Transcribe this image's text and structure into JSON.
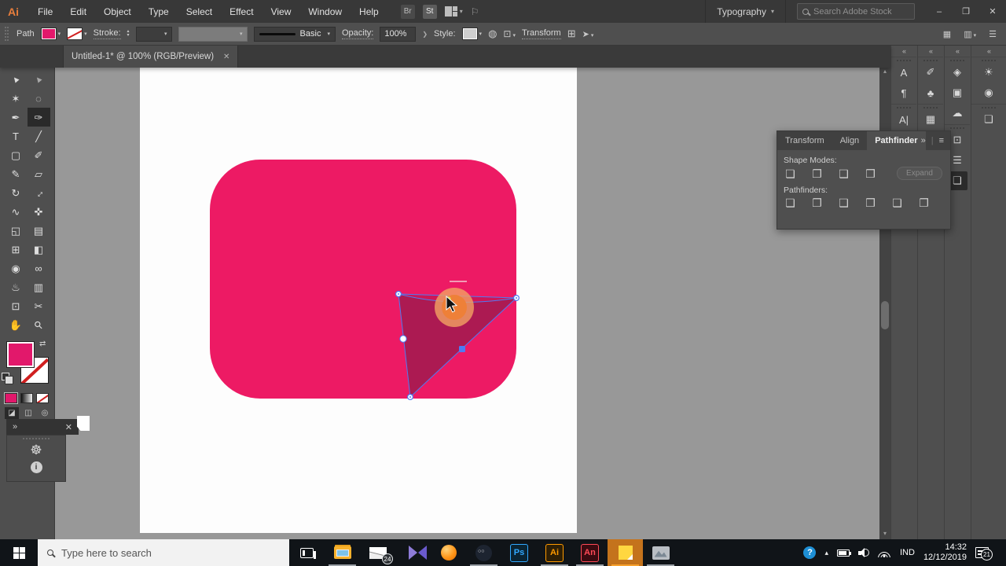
{
  "colors": {
    "rect": "#ED1A64",
    "tri": "#AC1A52",
    "sel": "#4E7BF3",
    "hl_in": "#EE8038",
    "hl_out": "#F2A263",
    "swatch": "#E2186B",
    "taskbar_orange": "#C4731C"
  },
  "menubar": {
    "logo": "Ai",
    "items": [
      {
        "label": "File"
      },
      {
        "label": "Edit"
      },
      {
        "label": "Object"
      },
      {
        "label": "Type"
      },
      {
        "label": "Select"
      },
      {
        "label": "Effect"
      },
      {
        "label": "View"
      },
      {
        "label": "Window"
      },
      {
        "label": "Help"
      }
    ],
    "bridge": "Br",
    "stock": "St",
    "workspace": "Typography",
    "search_placeholder": "Search Adobe Stock",
    "win": {
      "min": "–",
      "restore": "❐",
      "close": "✕"
    }
  },
  "controlbar": {
    "selection_label": "Path",
    "stroke_label": "Stroke:",
    "brush_name": "Basic",
    "opacity_label": "Opacity:",
    "opacity_value": "100%",
    "style_label": "Style:",
    "transform_label": "Transform"
  },
  "tab": {
    "title": "Untitled-1* @ 100% (RGB/Preview)",
    "close": "✕"
  },
  "tools": [
    {
      "name": "selection-tool",
      "g": "▲",
      "cls": "rotl"
    },
    {
      "name": "direct-selection-tool",
      "g": "▲",
      "cls": "rotl dim"
    },
    {
      "name": "magic-wand-tool",
      "g": "✶"
    },
    {
      "name": "lasso-tool",
      "g": "◌"
    },
    {
      "name": "pen-tool",
      "g": "✒"
    },
    {
      "name": "curvature-tool",
      "g": "✑",
      "cls": "active"
    },
    {
      "name": "type-tool",
      "g": "T"
    },
    {
      "name": "line-segment-tool",
      "g": "╱"
    },
    {
      "name": "rectangle-tool",
      "g": "▢"
    },
    {
      "name": "paintbrush-tool",
      "g": "✐"
    },
    {
      "name": "shaper-tool",
      "g": "✎"
    },
    {
      "name": "eraser-tool",
      "g": "▱"
    },
    {
      "name": "rotate-tool",
      "g": "↻"
    },
    {
      "name": "scale-tool",
      "g": "↔",
      "cls": "rotd"
    },
    {
      "name": "width-tool",
      "g": "∿"
    },
    {
      "name": "puppet-warp-tool",
      "g": "✜"
    },
    {
      "name": "shape-builder-tool",
      "g": "◱"
    },
    {
      "name": "perspective-grid-tool",
      "g": "▤"
    },
    {
      "name": "mesh-tool",
      "g": "⊞"
    },
    {
      "name": "gradient-tool",
      "g": "◧"
    },
    {
      "name": "eyedropper-tool",
      "g": "◉"
    },
    {
      "name": "blend-tool",
      "g": "∞"
    },
    {
      "name": "symbol-sprayer-tool",
      "g": "♨"
    },
    {
      "name": "graph-tool",
      "g": "▥"
    },
    {
      "name": "artboard-tool",
      "g": "⊡"
    },
    {
      "name": "slice-tool",
      "g": "✂"
    },
    {
      "name": "hand-tool",
      "g": "✋"
    },
    {
      "name": "zoom-tool",
      "g": "⚲",
      "cls": "rotd"
    }
  ],
  "pathfinder": {
    "tabs": [
      {
        "label": "Transform",
        "name": "tab-transform"
      },
      {
        "label": "Align",
        "name": "tab-align"
      },
      {
        "label": "Pathfinder",
        "name": "tab-pathfinder",
        "cls": "active"
      }
    ],
    "collapse": "»",
    "menu": "≡",
    "shape_modes_label": "Shape Modes:",
    "expand_label": "Expand",
    "pathfinders_label": "Pathfinders:",
    "shape_modes": [
      {
        "name": "unite-button",
        "g": "❏"
      },
      {
        "name": "minus-front-button",
        "g": "❐"
      },
      {
        "name": "intersect-button",
        "g": "❑"
      },
      {
        "name": "exclude-button",
        "g": "❒"
      }
    ],
    "pathfinders": [
      {
        "name": "divide-button",
        "g": "❏"
      },
      {
        "name": "trim-button",
        "g": "❐"
      },
      {
        "name": "merge-button",
        "g": "❑"
      },
      {
        "name": "crop-button",
        "g": "❒"
      },
      {
        "name": "outline-button",
        "g": "❏"
      },
      {
        "name": "minus-back-button",
        "g": "❐"
      }
    ]
  },
  "dock": {
    "collapse": "«",
    "col1": [
      {
        "name": "character-styles-icon",
        "g": "A"
      },
      {
        "name": "paragraph-styles-icon",
        "g": "¶"
      }
    ],
    "col1b": [
      {
        "name": "character-panel-icon",
        "g": "A|"
      },
      {
        "name": "opentype-icon",
        "g": "▤"
      }
    ],
    "col2": [
      {
        "name": "brushes-icon",
        "g": "✐"
      },
      {
        "name": "symbols-icon",
        "g": "♣"
      }
    ],
    "col2b": [
      {
        "name": "glyphs-icon",
        "g": "▦"
      }
    ],
    "col3": [
      {
        "name": "layers-icon",
        "g": "◈"
      },
      {
        "name": "asset-export-icon",
        "g": "▣"
      },
      {
        "name": "cc-libraries-icon",
        "g": "☁"
      }
    ],
    "col3b": [
      {
        "name": "transform-panel-icon",
        "g": "⊡"
      },
      {
        "name": "align-panel-icon",
        "g": "☰"
      },
      {
        "name": "pathfinder-panel-icon",
        "g": "❏",
        "cls": "active"
      }
    ],
    "col4": [
      {
        "name": "color-icon",
        "g": "☀"
      },
      {
        "name": "color-guide-icon",
        "g": "◉"
      }
    ],
    "col4b": [
      {
        "name": "appearance-icon",
        "g": "❏"
      }
    ]
  },
  "mini_panel": {
    "expand": "»",
    "close": "✕",
    "wheel": "☸",
    "info": "i"
  },
  "taskbar": {
    "search_placeholder": "Type here to search",
    "apps": [
      {
        "name": "task-view-button",
        "cls": "icon-taskview"
      },
      {
        "name": "file-explorer-icon",
        "cls": "icon-folder ul"
      },
      {
        "name": "mail-icon",
        "cls": "icon-mail",
        "badge": "24"
      },
      {
        "name": "kmplayer-icon",
        "cls": "icon-km"
      },
      {
        "name": "orange-ball-app-icon",
        "cls": "icon-ball"
      },
      {
        "name": "round-dark-app-icon",
        "cls": "icon-disc ul"
      },
      {
        "name": "photoshop-icon",
        "cls": "icon-adobe",
        "label": "Ps",
        "fg": "#31A8FF",
        "bd": "#31A8FF",
        "bg": "#0A2433"
      },
      {
        "name": "illustrator-icon",
        "cls": "icon-adobe ul",
        "label": "Ai",
        "fg": "#FF9A00",
        "bd": "#FF9A00",
        "bg": "#2E1F05"
      },
      {
        "name": "animate-icon",
        "cls": "icon-adobe ul",
        "label": "An",
        "fg": "#FF4A57",
        "bd": "#FF4A57",
        "bg": "#3A0A10"
      },
      {
        "name": "sticky-notes-icon",
        "cls": "icon-sticky ul-orange"
      },
      {
        "name": "photo-viewer-icon",
        "cls": "icon-photo ul"
      }
    ],
    "tray": {
      "help": "?",
      "chevron": "▴",
      "lang": "IND",
      "time": "14:32",
      "date": "12/12/2019",
      "badge": "21"
    }
  }
}
